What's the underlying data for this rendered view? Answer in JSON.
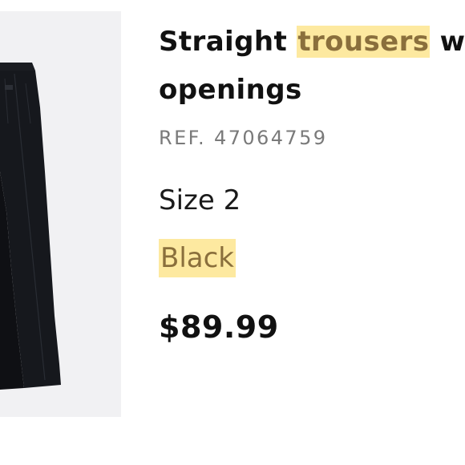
{
  "product": {
    "title_line1_pre": "Straight ",
    "title_highlight": "trousers",
    "title_line1_post": " w",
    "title_line2": "openings",
    "ref": "REF. 47064759",
    "size": "Size 2",
    "color": "Black",
    "price": "$89.99"
  },
  "colors": {
    "highlight_bg": "#fde9a0",
    "highlight_text": "#8a6f3c",
    "image_bg": "#f1f1f3",
    "garment": "#16181d"
  },
  "icons": {
    "product_image": "black-trousers-photo"
  }
}
